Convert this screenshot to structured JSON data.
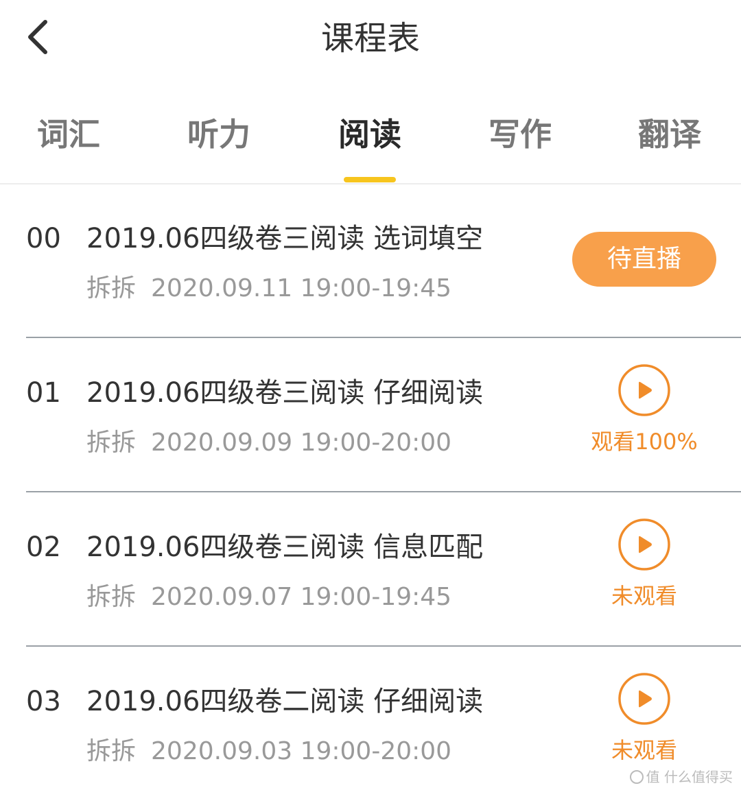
{
  "header": {
    "back_icon": "chevron-left-icon",
    "title": "课程表"
  },
  "tabs": [
    {
      "label": "词汇",
      "active": false
    },
    {
      "label": "听力",
      "active": false
    },
    {
      "label": "阅读",
      "active": true
    },
    {
      "label": "写作",
      "active": false
    },
    {
      "label": "翻译",
      "active": false
    }
  ],
  "colors": {
    "accent": "#f8a04b",
    "tab_indicator": "#f7c51e",
    "status_text": "#f08c2a"
  },
  "lessons": [
    {
      "num": "00",
      "title": "2019.06四级卷三阅读 选词填空",
      "teacher": "拆拆",
      "time": "2020.09.11 19:00-19:45",
      "action": "待直播"
    },
    {
      "num": "01",
      "title": "2019.06四级卷三阅读 仔细阅读",
      "teacher": "拆拆",
      "time": "2020.09.09 19:00-20:00",
      "status": "观看100%",
      "icon": "play-icon"
    },
    {
      "num": "02",
      "title": "2019.06四级卷三阅读 信息匹配",
      "teacher": "拆拆",
      "time": "2020.09.07 19:00-19:45",
      "status": "未观看",
      "icon": "play-icon"
    },
    {
      "num": "03",
      "title": "2019.06四级卷二阅读 仔细阅读",
      "teacher": "拆拆",
      "time": "2020.09.03 19:00-20:00",
      "status": "未观看",
      "icon": "play-icon"
    }
  ],
  "watermark": "值 什么值得买"
}
